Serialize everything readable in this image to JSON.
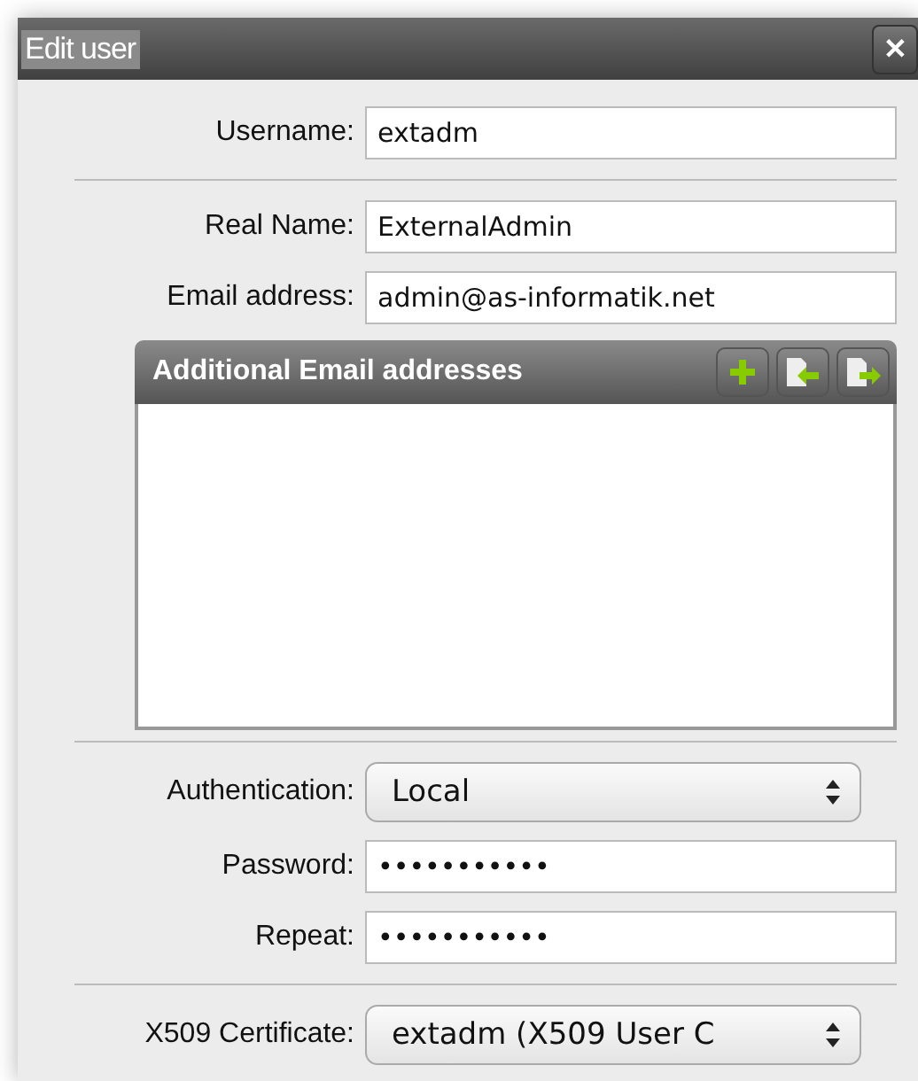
{
  "window": {
    "title": "Edit user",
    "close": "✕"
  },
  "sections": [
    {
      "fields": [
        {
          "label": "Username:",
          "value": "extadm",
          "kind": "text"
        }
      ]
    },
    {
      "fields": [
        {
          "label": "Real Name:",
          "value": "ExternalAdmin",
          "kind": "text"
        },
        {
          "label": "Email address:",
          "value": "admin@as-informatik.net",
          "kind": "text"
        }
      ],
      "list": {
        "title": "Additional Email addresses"
      }
    },
    {
      "fields": [
        {
          "label": "Authentication:",
          "value": "Local",
          "kind": "select"
        },
        {
          "label": "Password:",
          "value": "•••••••••••",
          "kind": "text"
        },
        {
          "label": "Repeat:",
          "value": "•••••••••••",
          "kind": "text"
        }
      ]
    },
    {
      "fields": [
        {
          "label": "X509 Certificate:",
          "value": "extadm (X509 User C",
          "kind": "select"
        }
      ]
    }
  ]
}
